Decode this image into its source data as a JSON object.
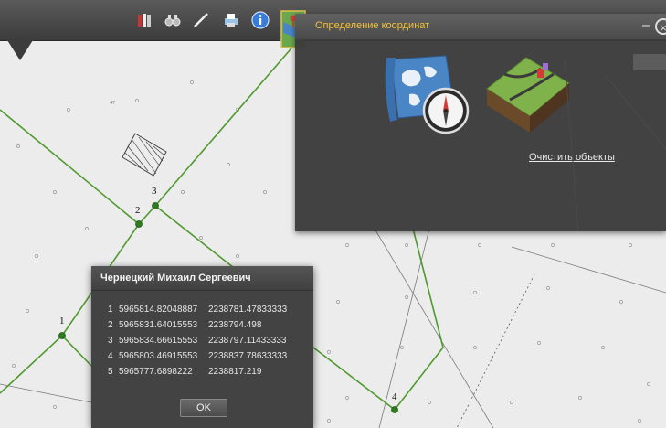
{
  "panel": {
    "title": "Определение координат",
    "clear_link": "Очистить объекты",
    "min_symbol": "–",
    "close_symbol": "×"
  },
  "dialog": {
    "title": "Чернецкий Михаил Сергеевич",
    "ok_label": "OK",
    "rows": [
      {
        "n": "1",
        "x": "5965814.82048887",
        "y": "2238781.47833333"
      },
      {
        "n": "2",
        "x": "5965831.64015553",
        "y": "2238794.498"
      },
      {
        "n": "3",
        "x": "5965834.66615553",
        "y": "2238797.11433333"
      },
      {
        "n": "4",
        "x": "5965803.46915553",
        "y": "2238837.78633333"
      },
      {
        "n": "5",
        "x": "5965777.6898222",
        "y": "2238817.219"
      }
    ]
  },
  "map": {
    "point_labels": [
      "1",
      "2",
      "3",
      "4"
    ],
    "small_label": "47"
  },
  "toolbar": {
    "icons": [
      "layers-icon",
      "binoculars-icon",
      "ruler-icon",
      "print-icon",
      "info-icon",
      "map-coordinates-icon"
    ]
  },
  "colors": {
    "boundary_line": "#4f9a2e",
    "panel_title": "#f0c23a",
    "panel_bg": "#3a3a3a"
  }
}
